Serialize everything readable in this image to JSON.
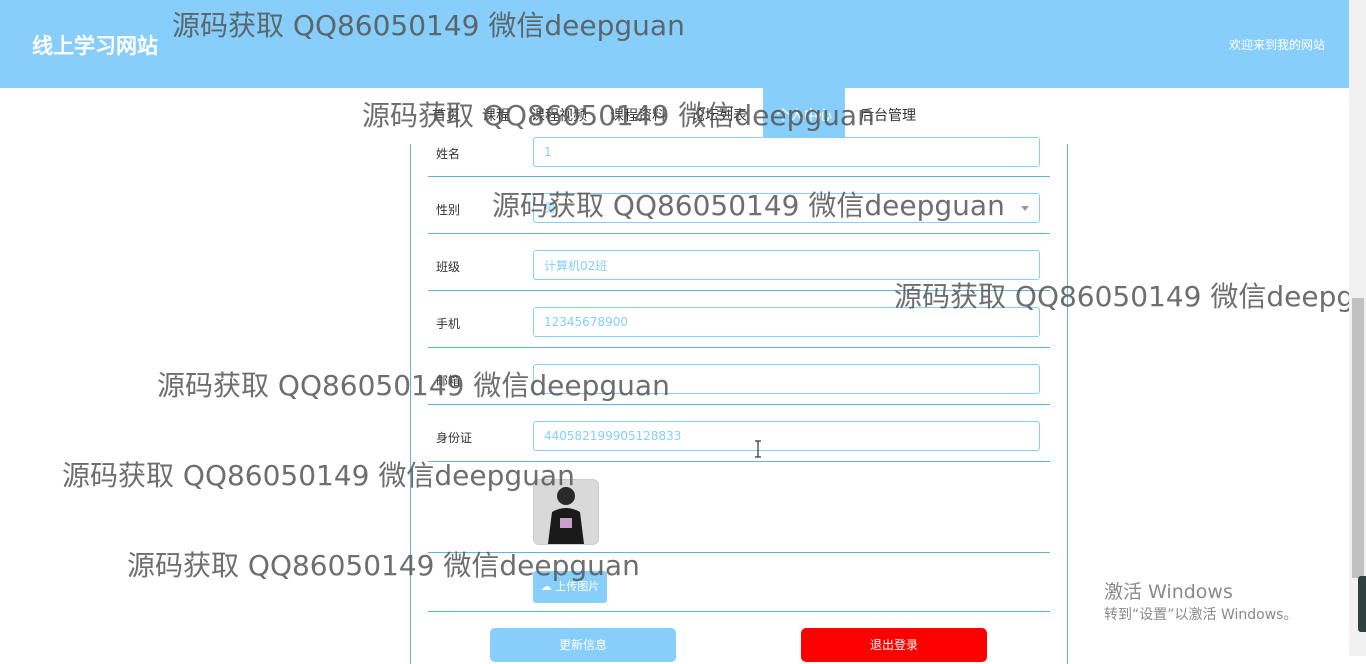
{
  "header": {
    "site_title": "线上学习网站",
    "welcome": "欢迎来到我的网站"
  },
  "nav": {
    "items": [
      "首页",
      "课程",
      "课程视频",
      "课程资料",
      "论坛列表",
      "个人中心",
      "后台管理"
    ],
    "active_index": 5
  },
  "form": {
    "name_label": "姓名",
    "name_value": "1",
    "gender_label": "性别",
    "gender_value": "男",
    "class_label": "班级",
    "class_value": "计算机02班",
    "phone_label": "手机",
    "phone_value": "12345678900",
    "email_label": "邮箱",
    "email_value": "",
    "idcard_label": "身份证",
    "idcard_value": "440582199905128833",
    "upload_label": "上传图片",
    "update_button": "更新信息",
    "logout_button": "退出登录"
  },
  "colors": {
    "primary": "#87cefa",
    "danger": "#ff0000",
    "border": "#5bb8d7"
  },
  "watermark": {
    "text": "源码获取 QQ86050149 微信deepguan"
  },
  "system": {
    "activate_title": "激活 Windows",
    "activate_sub": "转到“设置”以激活 Windows。"
  }
}
